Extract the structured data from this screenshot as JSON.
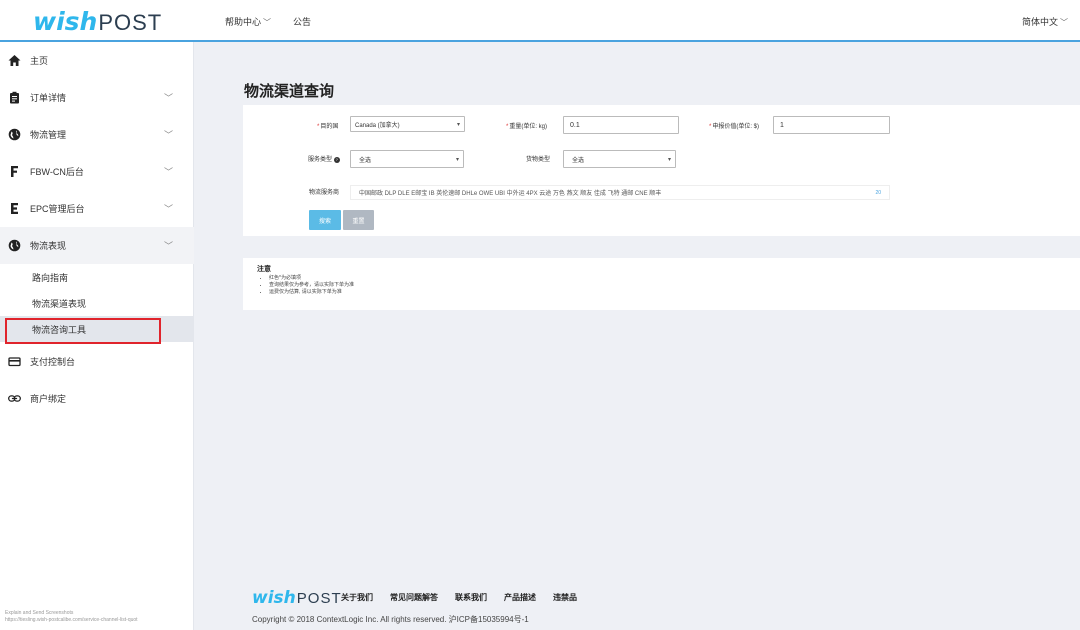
{
  "header": {
    "logo_wish": "wish",
    "logo_post": "POST",
    "help_center": "帮助中心",
    "notice": "公告",
    "language": "简体中文"
  },
  "sidebar": {
    "items": [
      {
        "label": "主页",
        "icon": "home-icon"
      },
      {
        "label": "订单详情",
        "icon": "clipboard-icon"
      },
      {
        "label": "物流管理",
        "icon": "globe-icon"
      },
      {
        "label": "FBW-CN后台",
        "icon": "f-icon"
      },
      {
        "label": "EPC管理后台",
        "icon": "e-icon"
      },
      {
        "label": "物流表现",
        "icon": "globe-icon"
      },
      {
        "label": "支付控制台",
        "icon": "credit-card-icon"
      },
      {
        "label": "商户绑定",
        "icon": "link-icon"
      }
    ],
    "subitems": [
      {
        "label": "路向指南"
      },
      {
        "label": "物流渠道表现"
      },
      {
        "label": "物流咨询工具"
      }
    ],
    "watermark_line1": "Explain and Send Screenshots",
    "watermark_line2": "https://tiesling.wish-postcalibe.com/service-channel-list-quot"
  },
  "main": {
    "title": "物流渠道查询",
    "form": {
      "destination_label": "目的国",
      "destination_value": "Canada (加拿大)",
      "weight_label": "重量(单位: kg)",
      "weight_value": "0.1",
      "declared_label": "申报价值(单位: $)",
      "declared_value": "1",
      "service_type_label": "服务类型",
      "service_type_value": "全选",
      "goods_type_label": "货物类型",
      "goods_type_value": "全选",
      "provider_label": "物流服务商",
      "provider_value": "中国邮政 DLP DLE E邮宝 IB 英伦速邮 DHLe OWE UBI 中外运 4PX 云途 万色 燕文 顺友 佳成 飞特 通邮 CNE 顺丰",
      "provider_count": "20",
      "search_button": "搜索",
      "reset_button": "重置"
    },
    "notes": {
      "title": "注意",
      "items": [
        "红色*为必填项",
        "查询结果仅为参考，请以实际下单为准",
        "运费仅为估算, 请以实际下单为准"
      ]
    }
  },
  "footer": {
    "links": [
      "关于我们",
      "常见问题解答",
      "联系我们",
      "产品描述",
      "违禁品"
    ],
    "copyright": "Copyright © 2018 ContextLogic Inc. All rights reserved. 沪ICP备15035994号-1"
  },
  "colors": {
    "accent": "#4aa3df",
    "logo_blue": "#2fb7ec",
    "highlight_red": "#e0242c",
    "search_button": "#5bbbe6",
    "reset_button": "#b0b8c2"
  }
}
